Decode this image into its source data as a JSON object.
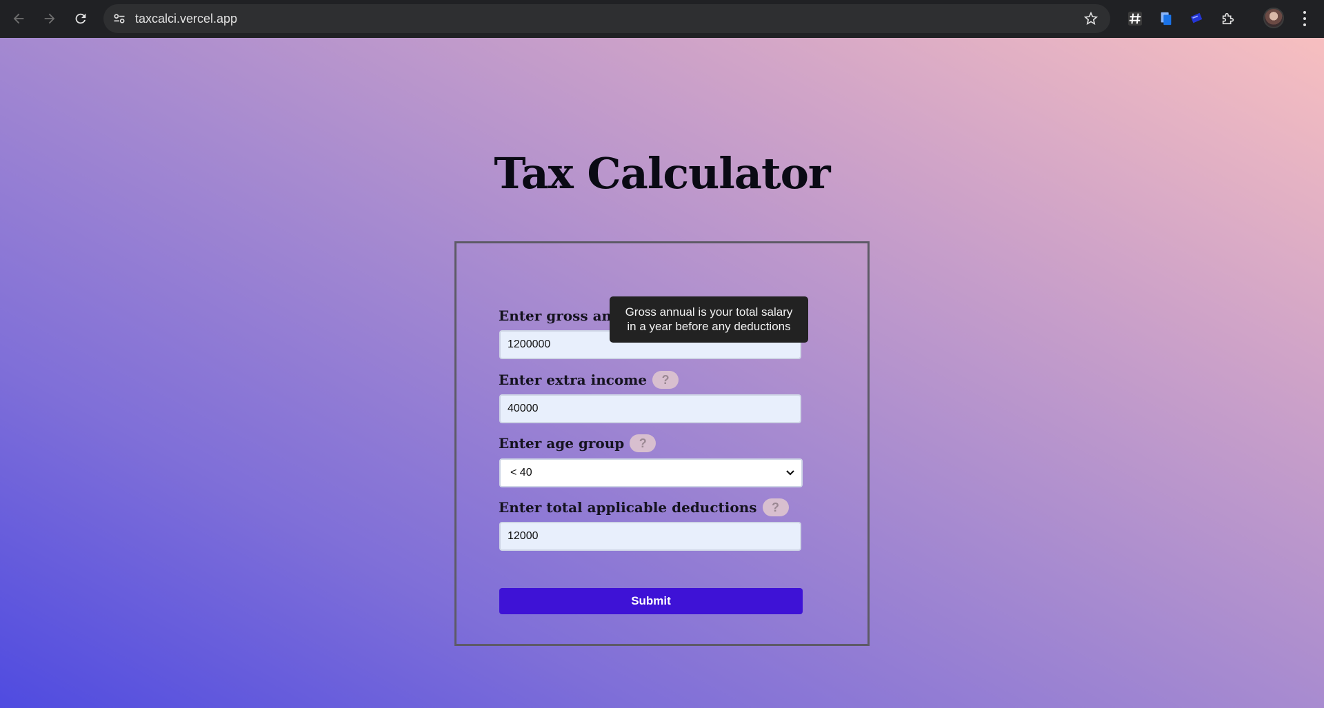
{
  "browser": {
    "url": "taxcalci.vercel.app"
  },
  "page": {
    "title": "Tax Calculator",
    "fields": {
      "gross": {
        "label": "Enter gross annual income",
        "value": "1200000"
      },
      "extra": {
        "label": "Enter extra income",
        "value": "40000"
      },
      "age": {
        "label": "Enter age group",
        "selected": "< 40"
      },
      "deductions": {
        "label": "Enter total applicable deductions",
        "value": "12000"
      }
    },
    "help_glyph": "?",
    "submit_label": "Submit",
    "tooltip": {
      "line1": "Gross annual is your total salary",
      "line2": "in a year before any deductions"
    }
  }
}
